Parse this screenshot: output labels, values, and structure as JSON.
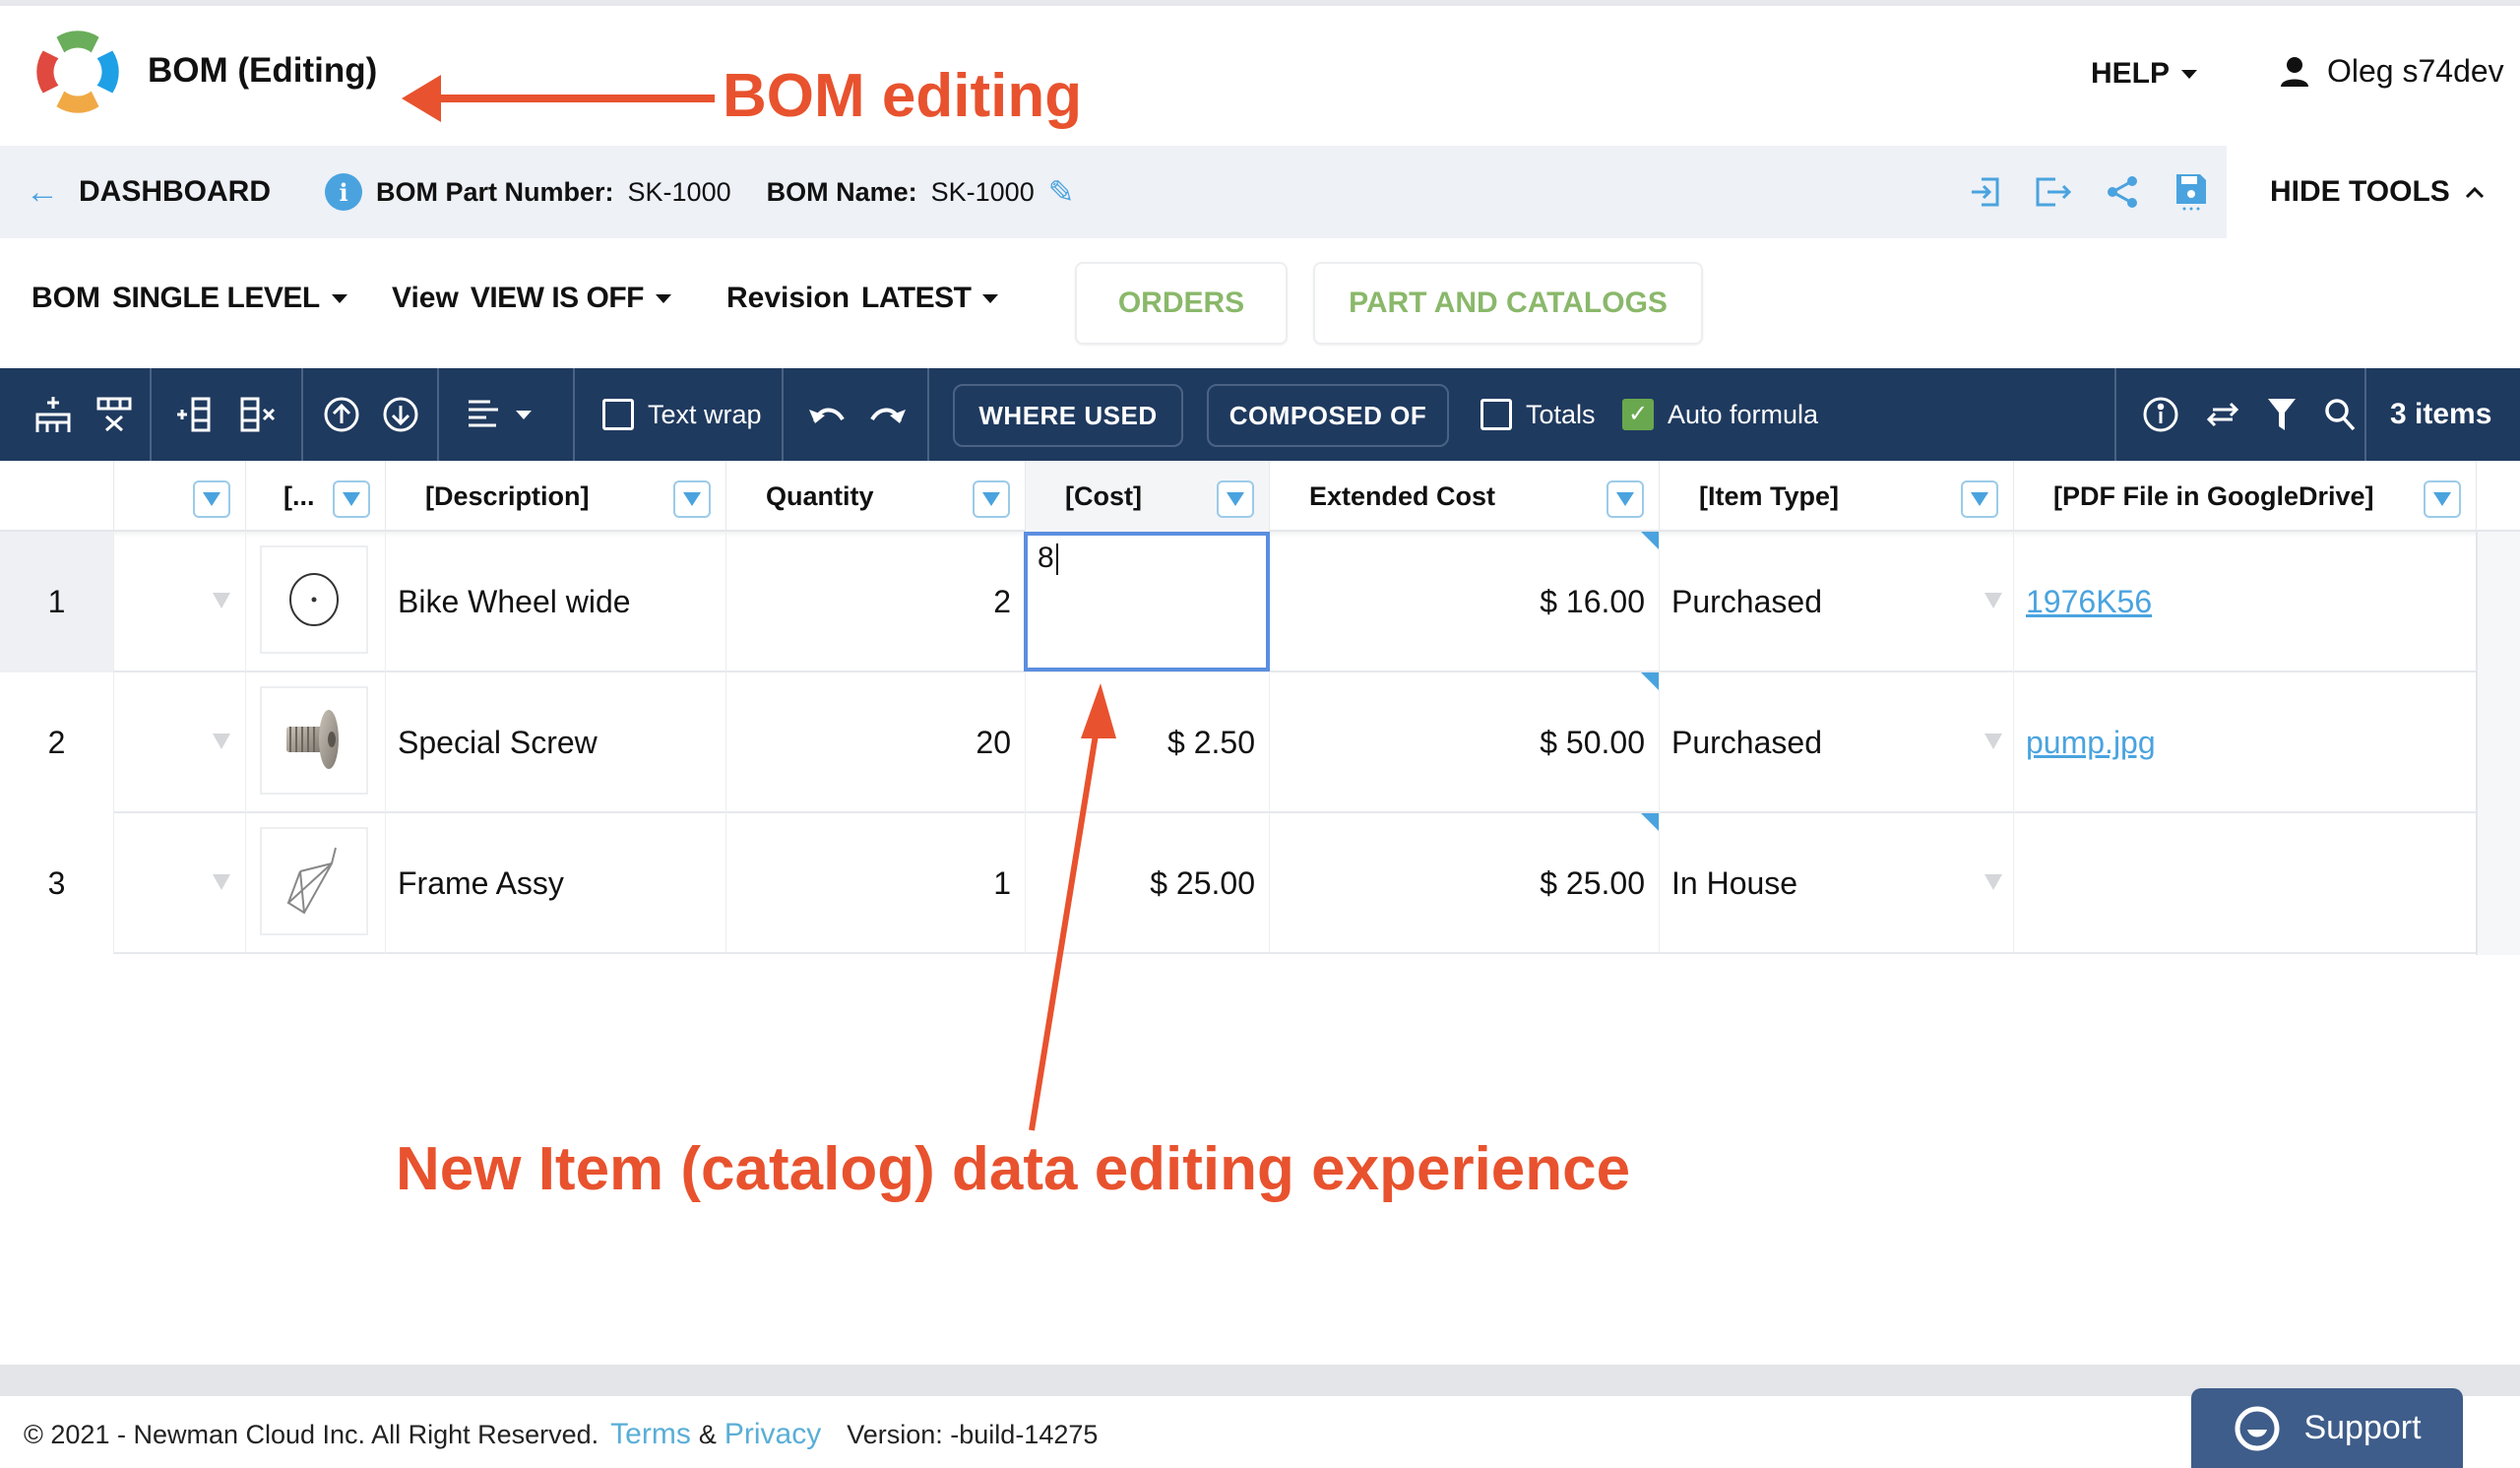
{
  "header": {
    "app_title": "BOM (Editing)",
    "help_label": "HELP",
    "user_name": "Oleg s74dev"
  },
  "breadcrumb": {
    "back_label": "DASHBOARD",
    "part_number_label": "BOM Part Number:",
    "part_number_value": "SK-1000",
    "bom_name_label": "BOM Name:",
    "bom_name_value": "SK-1000",
    "hide_tools_label": "HIDE TOOLS",
    "icons": [
      "import-icon",
      "export-icon",
      "share-icon",
      "save-icon"
    ]
  },
  "options": {
    "bom": {
      "label": "BOM",
      "value": "SINGLE LEVEL"
    },
    "view": {
      "label": "View",
      "value": "VIEW IS OFF"
    },
    "revision": {
      "label": "Revision",
      "value": "LATEST"
    },
    "orders_button": "ORDERS",
    "parts_catalogs_button": "PART AND CATALOGS"
  },
  "toolbar": {
    "text_wrap": {
      "label": "Text wrap",
      "checked": false
    },
    "where_used": "WHERE USED",
    "composed_of": "COMPOSED OF",
    "totals": {
      "label": "Totals",
      "checked": false
    },
    "auto_formula": {
      "label": "Auto formula",
      "checked": true
    },
    "items_count": "3 items"
  },
  "table": {
    "columns": [
      {
        "key": "num",
        "label": ""
      },
      {
        "key": "select",
        "label": ""
      },
      {
        "key": "image",
        "label": "[..."
      },
      {
        "key": "description",
        "label": "[Description]"
      },
      {
        "key": "quantity",
        "label": "Quantity"
      },
      {
        "key": "cost",
        "label": "[Cost]"
      },
      {
        "key": "extended_cost",
        "label": "Extended Cost"
      },
      {
        "key": "item_type",
        "label": "[Item Type]"
      },
      {
        "key": "pdf_file",
        "label": "[PDF File in GoogleDrive]"
      }
    ],
    "rows": [
      {
        "num": "1",
        "image": "bike-wheel-image",
        "description": "Bike Wheel wide",
        "quantity": "2",
        "cost": "",
        "extended_cost": "$ 16.00",
        "item_type": "Purchased",
        "pdf_file": "1976K56"
      },
      {
        "num": "2",
        "image": "special-screw-image",
        "description": "Special Screw",
        "quantity": "20",
        "cost": "$ 2.50",
        "extended_cost": "$ 50.00",
        "item_type": "Purchased",
        "pdf_file": "pump.jpg"
      },
      {
        "num": "3",
        "image": "frame-assy-image",
        "description": "Frame Assy",
        "quantity": "1",
        "cost": "$ 25.00",
        "extended_cost": "$ 25.00",
        "item_type": "In House",
        "pdf_file": ""
      }
    ],
    "editing_cell": {
      "row": 1,
      "column": "cost",
      "value": "8"
    }
  },
  "footer": {
    "copyright": "© 2021 - Newman Cloud Inc. All Right Reserved.",
    "terms": "Terms",
    "amp": "&",
    "privacy": "Privacy",
    "version": "Version: -build-14275",
    "support_label": "Support"
  },
  "annotations": {
    "top": "BOM editing",
    "bottom": "New Item (catalog) data editing experience",
    "color": "#e8522e"
  },
  "colors": {
    "toolbar_bg": "#1f3a5f",
    "accent_blue": "#4aa3df",
    "green": "#8ab86a",
    "edit_border": "#5b8ee0"
  }
}
